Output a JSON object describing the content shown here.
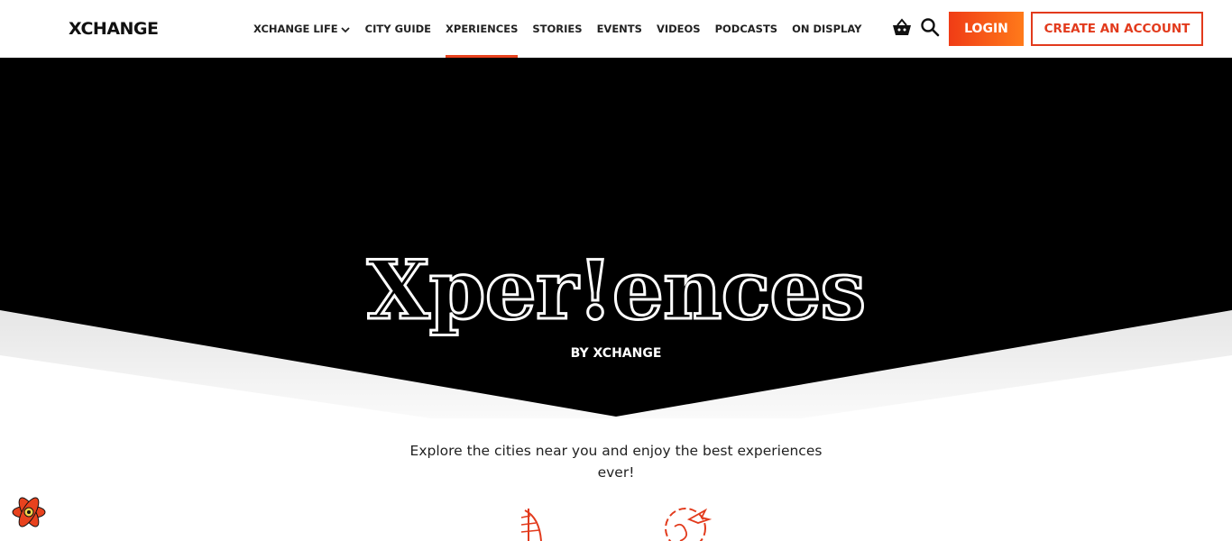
{
  "nav": {
    "logo": "XCHANGE",
    "menu": [
      {
        "label": "XCHANGE LIFE",
        "dropdown": true
      },
      {
        "label": "CITY GUIDE"
      },
      {
        "label": "XPERIENCES",
        "active": true
      },
      {
        "label": "STORIES"
      },
      {
        "label": "EVENTS"
      },
      {
        "label": "VIDEOS"
      },
      {
        "label": "PODCASTS"
      },
      {
        "label": "ON DISPLAY"
      }
    ],
    "login_label": "LOGIN",
    "create_account_label": "CREATE AN ACCOUNT",
    "cart_icon": "basket-icon",
    "search_icon": "search-icon"
  },
  "hero": {
    "title": "Xper!ences",
    "subtitle": "BY XCHANGE"
  },
  "tagline": "Explore the cities near you and enjoy the best experiences ever!",
  "colors": {
    "accent": "#e8421e",
    "accent_gradient_end": "#ff7a1a",
    "hero_bg": "#000000"
  },
  "icons": [
    "react-logo-icon",
    "burj-al-arab-icon",
    "travel-globe-icon"
  ]
}
